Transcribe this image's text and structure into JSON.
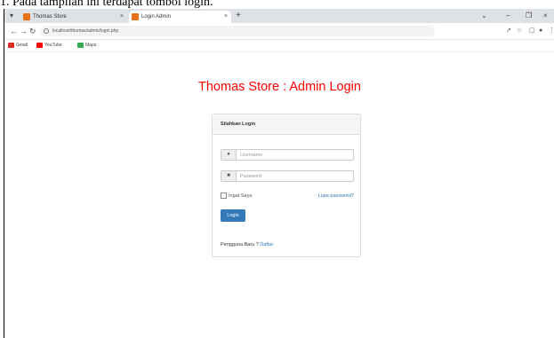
{
  "caption": "1. Pada tampilan ini terdapat tombol login.",
  "browser": {
    "tabs": [
      {
        "label": "Thomas Store",
        "color": "#e8711a",
        "active": false
      },
      {
        "label": "Login Admin",
        "color": "#e8711a",
        "active": true
      }
    ],
    "url": "localhost/thomas/admin/login.php",
    "bookmarks": [
      {
        "label": "Gmail",
        "icon": "gmail-icon",
        "color": "#d93025"
      },
      {
        "label": "YouTube",
        "icon": "youtube-icon",
        "color": "#ff0000"
      },
      {
        "label": "Maps",
        "icon": "maps-icon",
        "color": "#34a853"
      }
    ]
  },
  "page": {
    "title": "Thomas Store : Admin Login",
    "panel_heading": "Silahkan Login",
    "username_placeholder": "Username",
    "password_placeholder": "Password",
    "remember_label": "Ingat Saya",
    "forgot_label": "Lupa password?",
    "login_button": "Login",
    "register_prefix": "Pengguna Baru ?",
    "register_link": "Daftar"
  },
  "colors": {
    "title": "#ff0000",
    "primary": "#337ab7"
  }
}
